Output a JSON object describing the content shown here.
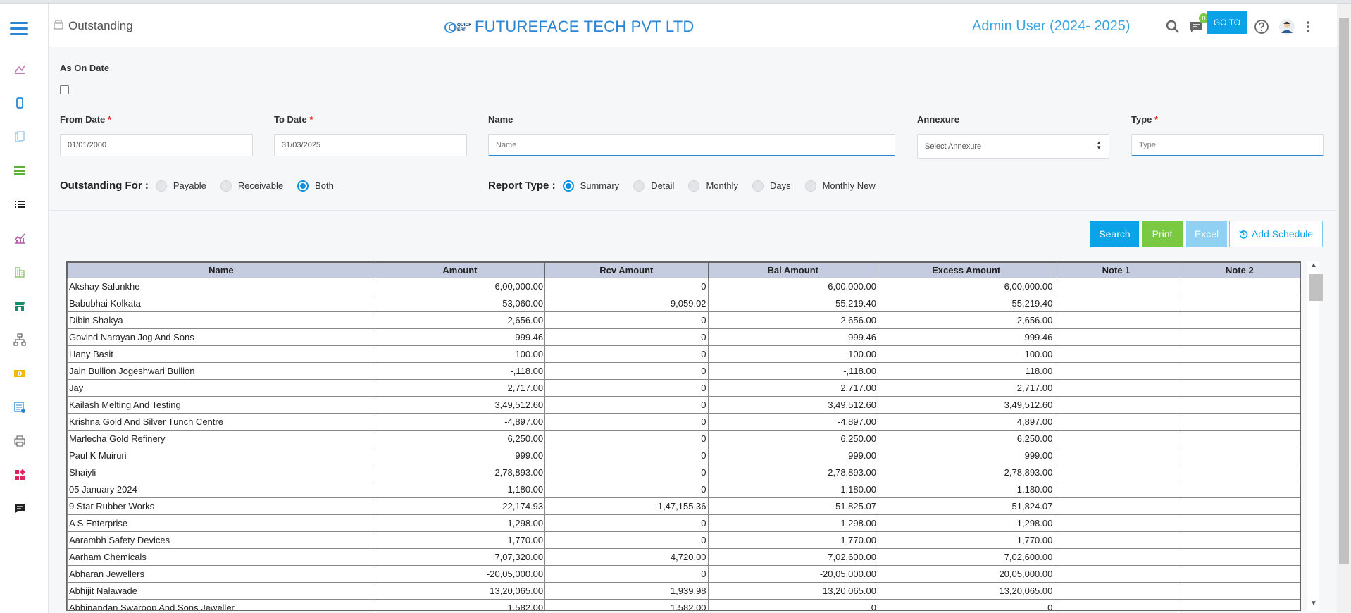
{
  "header": {
    "breadcrumb": "Outstanding",
    "company": "FUTUREFACE TECH PVT LTD",
    "logo_text": "QUICK ERP",
    "user": "Admin User (2024- 2025)",
    "chat_badge": "0",
    "goto_label": "GO TO"
  },
  "filters": {
    "as_on_date_label": "As On Date",
    "from_date_label": "From Date",
    "from_date_value": "01/01/2000",
    "to_date_label": "To Date",
    "to_date_value": "31/03/2025",
    "name_label": "Name",
    "name_placeholder": "Name",
    "annexure_label": "Annexure",
    "annexure_value": "Select Annexure",
    "type_label": "Type",
    "type_placeholder": "Type",
    "required_mark": "*"
  },
  "outstanding_for": {
    "title": "Outstanding For :",
    "options": [
      "Payable",
      "Receivable",
      "Both"
    ],
    "selected": "Both"
  },
  "report_type": {
    "title": "Report Type :",
    "options": [
      "Summary",
      "Detail",
      "Monthly",
      "Days",
      "Monthly New"
    ],
    "selected": "Summary"
  },
  "buttons": {
    "search": "Search",
    "print": "Print",
    "excel": "Excel",
    "add_schedule": "Add Schedule"
  },
  "table": {
    "columns": [
      "Name",
      "Amount",
      "Rcv Amount",
      "Bal Amount",
      "Excess Amount",
      "Note 1",
      "Note 2"
    ],
    "rows": [
      [
        "Akshay Salunkhe",
        "6,00,000.00",
        "0",
        "6,00,000.00",
        "6,00,000.00",
        "",
        ""
      ],
      [
        "Babubhai Kolkata",
        "53,060.00",
        "9,059.02",
        "55,219.40",
        "55,219.40",
        "",
        ""
      ],
      [
        "Dibin Shakya",
        "2,656.00",
        "0",
        "2,656.00",
        "2,656.00",
        "",
        ""
      ],
      [
        "Govind Narayan Jog And Sons",
        "999.46",
        "0",
        "999.46",
        "999.46",
        "",
        ""
      ],
      [
        "Hany Basit",
        "100.00",
        "0",
        "100.00",
        "100.00",
        "",
        ""
      ],
      [
        "Jain Bullion Jogeshwari Bullion",
        "-,118.00",
        "0",
        "-,118.00",
        "118.00",
        "",
        ""
      ],
      [
        "Jay",
        "2,717.00",
        "0",
        "2,717.00",
        "2,717.00",
        "",
        ""
      ],
      [
        "Kailash Melting And Testing",
        "3,49,512.60",
        "0",
        "3,49,512.60",
        "3,49,512.60",
        "",
        ""
      ],
      [
        "Krishna Gold And Silver Tunch Centre",
        "-4,897.00",
        "0",
        "-4,897.00",
        "4,897.00",
        "",
        ""
      ],
      [
        "Marlecha Gold Refinery",
        "6,250.00",
        "0",
        "6,250.00",
        "6,250.00",
        "",
        ""
      ],
      [
        "Paul K Muiruri",
        "999.00",
        "0",
        "999.00",
        "999.00",
        "",
        ""
      ],
      [
        "Shaiyli",
        "2,78,893.00",
        "0",
        "2,78,893.00",
        "2,78,893.00",
        "",
        ""
      ],
      [
        "05 January 2024",
        "1,180.00",
        "0",
        "1,180.00",
        "1,180.00",
        "",
        ""
      ],
      [
        "9 Star Rubber Works",
        "22,174.93",
        "1,47,155.36",
        "-51,825.07",
        "51,824.07",
        "",
        ""
      ],
      [
        "A S Enterprise",
        "1,298.00",
        "0",
        "1,298.00",
        "1,298.00",
        "",
        ""
      ],
      [
        "Aarambh Safety Devices",
        "1,770.00",
        "0",
        "1,770.00",
        "1,770.00",
        "",
        ""
      ],
      [
        "Aarham Chemicals",
        "7,07,320.00",
        "4,720.00",
        "7,02,600.00",
        "7,02,600.00",
        "",
        ""
      ],
      [
        "Abharan Jewellers",
        "-20,05,000.00",
        "0",
        "-20,05,000.00",
        "20,05,000.00",
        "",
        ""
      ],
      [
        "Abhijit Nalawade",
        "13,20,065.00",
        "1,939.98",
        "13,20,065.00",
        "13,20,065.00",
        "",
        ""
      ],
      [
        "Abhinandan Swaroop And Sons Jeweller",
        "1,582.00",
        "1,582.00",
        "0",
        "0",
        "",
        ""
      ]
    ]
  },
  "sidebar": {
    "icons": [
      "report-icon",
      "mobile-icon",
      "documents-icon",
      "ledger-icon",
      "list-icon",
      "chart-icon",
      "building-icon",
      "store-icon",
      "hierarchy-icon",
      "cash-icon",
      "invoice-icon",
      "printer-icon",
      "widgets-icon",
      "message-icon"
    ]
  },
  "colors": {
    "accent": "#0ba3e8",
    "print": "#7ac943",
    "excel": "#8fd0f3",
    "header_text": "#2a86d4",
    "table_header": "#c5ccdf"
  }
}
